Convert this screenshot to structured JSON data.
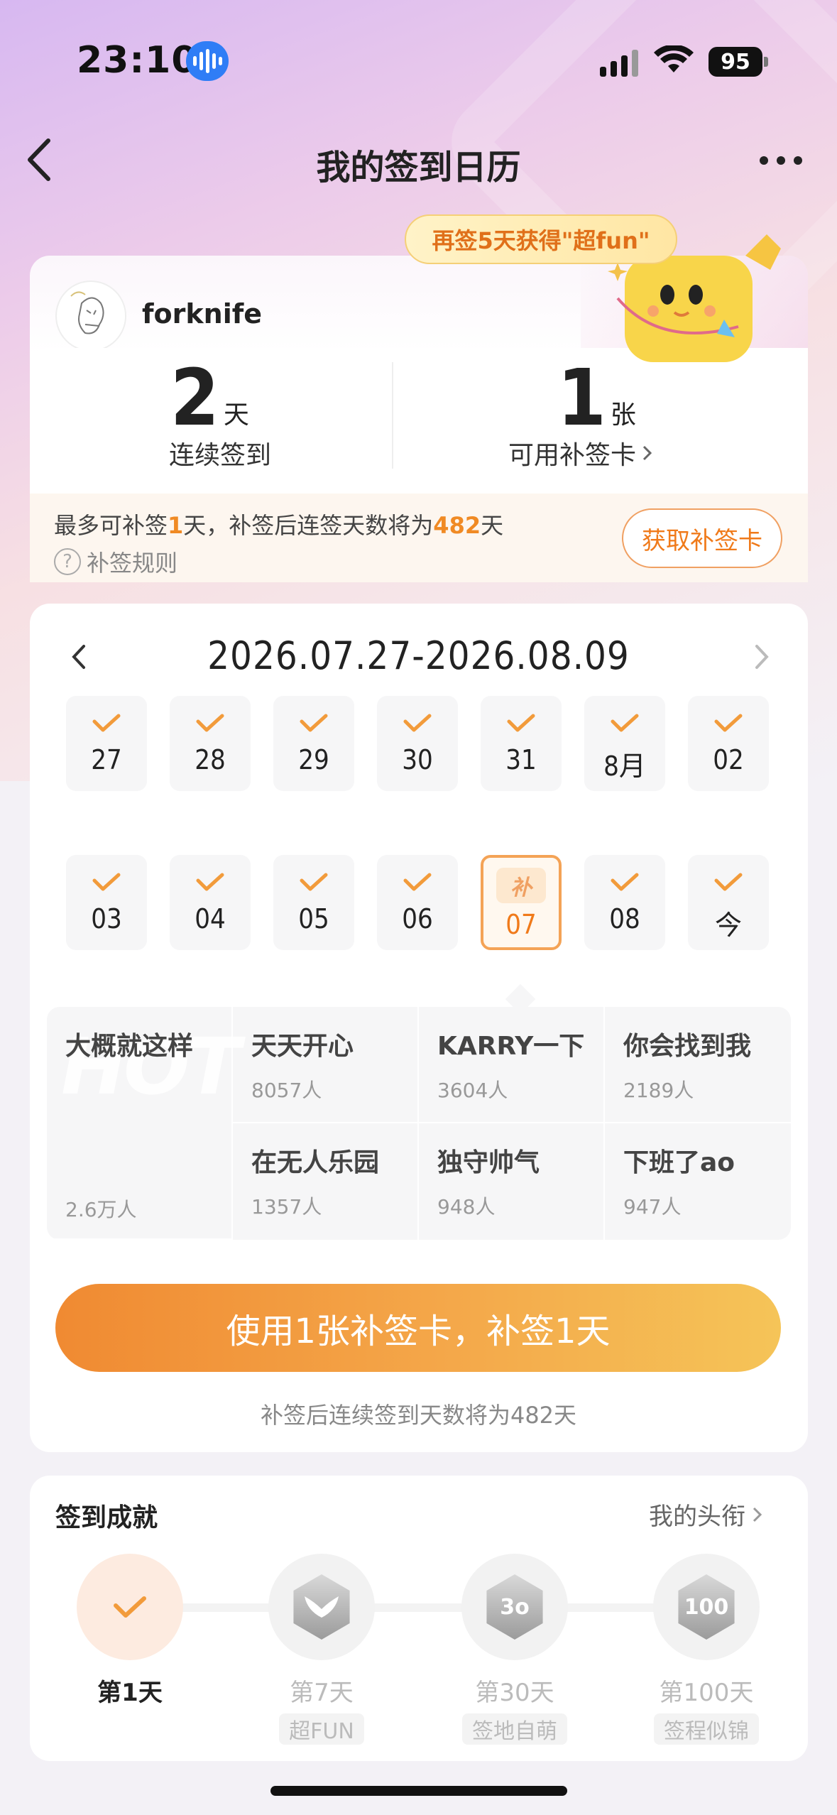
{
  "status": {
    "time": "23:10",
    "battery": "95"
  },
  "header": {
    "title": "我的签到日历"
  },
  "promo": {
    "bubble": "再签5天获得\"超fun\""
  },
  "profile": {
    "username": "forknife",
    "streak": {
      "value": "2",
      "unit": "天",
      "label": "连续签到"
    },
    "cards": {
      "value": "1",
      "unit": "张",
      "label": "可用补签卡"
    }
  },
  "makeup": {
    "text_prefix": "最多可补签",
    "days": "1",
    "text_mid": "天，补签后连签天数将为",
    "total": "482",
    "text_suffix": "天",
    "rules_icon": "?",
    "rules": "补签规则",
    "get_card": "获取补签卡"
  },
  "calendar": {
    "range": "2026.07.27-2026.08.09",
    "row1": [
      "27",
      "28",
      "29",
      "30",
      "31",
      "8月",
      "02"
    ],
    "row2": [
      "03",
      "04",
      "05",
      "06",
      "07",
      "08",
      "今"
    ],
    "makeup_badge": "补"
  },
  "ranking": [
    {
      "title": "大概就这样",
      "count": "2.6万人"
    },
    {
      "title": "天天开心",
      "count": "8057人"
    },
    {
      "title": "KARRY一下",
      "count": "3604人"
    },
    {
      "title": "你会找到我",
      "count": "2189人"
    },
    {
      "title": "在无人乐园",
      "count": "1357人"
    },
    {
      "title": "独守帅气",
      "count": "948人"
    },
    {
      "title": "下班了ao",
      "count": "947人"
    }
  ],
  "ranking_watermark": "HOT",
  "cta": {
    "label": "使用1张补签卡，补签1天",
    "note": "补签后连续签到天数将为482天"
  },
  "achievements": {
    "title": "签到成就",
    "link": "我的头衔",
    "items": [
      {
        "day": "第1天",
        "tag": ""
      },
      {
        "day": "第7天",
        "tag": "超FUN"
      },
      {
        "day": "第30天",
        "tag": "签地自萌"
      },
      {
        "day": "第100天",
        "tag": "签程似锦"
      }
    ],
    "badge_text": [
      "",
      "3o",
      "100"
    ]
  },
  "colors": {
    "accent": "#f08a24",
    "cta_start": "#f08a32",
    "cta_end": "#f5c458"
  }
}
